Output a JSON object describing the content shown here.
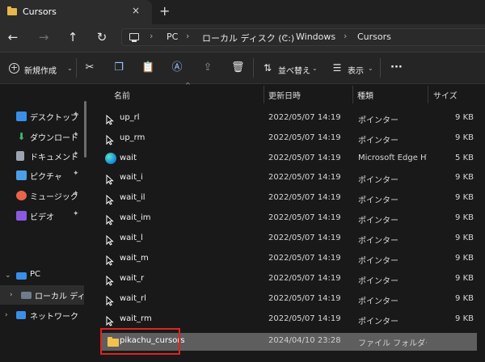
{
  "window": {
    "tab_title": "Cursors",
    "tab_close": "×",
    "new_tab": "+"
  },
  "nav": {
    "back": "←",
    "forward": "→",
    "up": "↑",
    "refresh": "↻"
  },
  "breadcrumb": [
    "PC",
    "ローカル ディスク (C:)",
    "Windows",
    "Cursors"
  ],
  "breadcrumb_separator": "›",
  "toolbar": {
    "new_label": "新規作成",
    "sort_label": "並べ替え",
    "view_label": "表示",
    "more_label": "···",
    "chevron": "⌄"
  },
  "sidebar": {
    "quick_access": [
      {
        "label": "デスクトップ",
        "icon": "desktop-icon",
        "color": "#3a8ee6"
      },
      {
        "label": "ダウンロード",
        "icon": "download-icon",
        "color": "#3fb96c"
      },
      {
        "label": "ドキュメント",
        "icon": "document-icon",
        "color": "#9aa4b2"
      },
      {
        "label": "ピクチャ",
        "icon": "pictures-icon",
        "color": "#4aa0e8"
      },
      {
        "label": "ミュージック",
        "icon": "music-icon",
        "color": "#e8644a"
      },
      {
        "label": "ビデオ",
        "icon": "video-icon",
        "color": "#8a5ae0"
      }
    ],
    "pin_glyph": "📌",
    "pc_label": "PC",
    "local_disk_label": "ローカル ディスク",
    "network_label": "ネットワーク"
  },
  "columns": {
    "name": "名前",
    "date": "更新日時",
    "type": "種類",
    "size": "サイズ"
  },
  "files": [
    {
      "name": "up_rl",
      "date": "2022/05/07 14:19",
      "type": "ポインター",
      "size": "9 KB",
      "icon": "cursor-icon"
    },
    {
      "name": "up_rm",
      "date": "2022/05/07 14:19",
      "type": "ポインター",
      "size": "9 KB",
      "icon": "cursor-icon"
    },
    {
      "name": "wait",
      "date": "2022/05/07 14:19",
      "type": "Microsoft Edge HT...",
      "size": "5 KB",
      "icon": "edge-icon"
    },
    {
      "name": "wait_i",
      "date": "2022/05/07 14:19",
      "type": "ポインター",
      "size": "9 KB",
      "icon": "cursor-icon"
    },
    {
      "name": "wait_il",
      "date": "2022/05/07 14:19",
      "type": "ポインター",
      "size": "9 KB",
      "icon": "cursor-icon"
    },
    {
      "name": "wait_im",
      "date": "2022/05/07 14:19",
      "type": "ポインター",
      "size": "9 KB",
      "icon": "cursor-icon"
    },
    {
      "name": "wait_l",
      "date": "2022/05/07 14:19",
      "type": "ポインター",
      "size": "9 KB",
      "icon": "cursor-icon"
    },
    {
      "name": "wait_m",
      "date": "2022/05/07 14:19",
      "type": "ポインター",
      "size": "9 KB",
      "icon": "cursor-icon"
    },
    {
      "name": "wait_r",
      "date": "2022/05/07 14:19",
      "type": "ポインター",
      "size": "9 KB",
      "icon": "cursor-icon"
    },
    {
      "name": "wait_rl",
      "date": "2022/05/07 14:19",
      "type": "ポインター",
      "size": "9 KB",
      "icon": "cursor-icon"
    },
    {
      "name": "wait_rm",
      "date": "2022/05/07 14:19",
      "type": "ポインター",
      "size": "9 KB",
      "icon": "cursor-icon"
    },
    {
      "name": "pikachu_cursors",
      "date": "2024/04/10 23:28",
      "type": "ファイル フォルダー",
      "size": "",
      "icon": "folder-icon",
      "selected": true
    }
  ],
  "colors": {
    "highlight_border": "#e0231f",
    "selected_row": "#5e5e5e",
    "folder": "#f2c14e"
  }
}
